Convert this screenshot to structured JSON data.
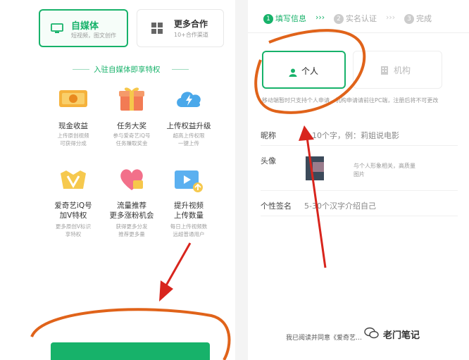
{
  "left": {
    "tab_active": {
      "title": "自媒体",
      "subtitle": "短视频，图文创作"
    },
    "tab_other": {
      "title": "更多合作",
      "subtitle": "10+合作渠道"
    },
    "section_title": "入驻自媒体即享特权",
    "features": [
      {
        "title": "现金收益",
        "desc1": "上传原创视频",
        "desc2": "可获得分成",
        "icon": "cash-icon"
      },
      {
        "title": "任务大奖",
        "desc1": "参与爱奇艺iQ号",
        "desc2": "任务赚取奖金",
        "icon": "gift-icon"
      },
      {
        "title": "上传权益升级",
        "desc1": "超高上传权限",
        "desc2": "一键上传",
        "icon": "cloud-upload-icon"
      },
      {
        "title": "爱奇艺iQ号",
        "title2": "加V特权",
        "desc1": "更多原创V标识",
        "desc2": "享特权",
        "icon": "v-badge-icon"
      },
      {
        "title": "流量推荐",
        "title2": "更多涨粉机会",
        "desc1": "获得更多分发",
        "desc2": "推荐更多量",
        "icon": "heart-icon"
      },
      {
        "title": "提升视频",
        "title2": "上传数量",
        "desc1": "每日上传视频数",
        "desc2": "远超普通用户",
        "icon": "video-icon"
      }
    ]
  },
  "right": {
    "steps": [
      {
        "num": "1",
        "label": "填写信息"
      },
      {
        "num": "2",
        "label": "实名认证"
      },
      {
        "num": "3",
        "label": "完成"
      }
    ],
    "step_sep": "›››",
    "type_personal": "个人",
    "type_org": "机构",
    "type_hint": "移动端暂时只支持个人申请，机构申请请前往PC端，注册后将不可更改",
    "nickname_label": "昵称",
    "nickname_placeholder": "2-10个字，例：莉姐说电影",
    "avatar_label": "头像",
    "avatar_hint": "与个人形象相关，高质量图片",
    "signature_label": "个性签名",
    "signature_placeholder": "5-30个汉字介绍自己",
    "agreement_text": "我已阅读并同意《爱奇艺…",
    "watermark": "老门笔记"
  },
  "colors": {
    "brand": "#17b26a",
    "annotation": "#e0631a",
    "arrow": "#d8251d"
  }
}
